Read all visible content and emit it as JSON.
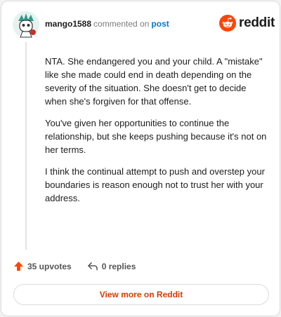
{
  "header": {
    "username": "mango1588",
    "action_text": "commented on",
    "post_link": "post",
    "logo_text": "reddit"
  },
  "comment": {
    "paragraphs": [
      "NTA. She endangered you and your child. A \"mistake\" like she made could end in death depending on the severity of the situation. She doesn't get to decide when she's forgiven for that offense.",
      "You've given her opportunities to continue the relationship, but she keeps pushing because it's not on her terms.",
      "I think the continual attempt to push and overstep your boundaries is reason enough not to trust her with your address."
    ]
  },
  "actions": {
    "upvotes": "35 upvotes",
    "replies": "0 replies"
  },
  "footer": {
    "view_more": "View more on Reddit"
  },
  "colors": {
    "brand": "#ff4500",
    "link": "#0079d3",
    "cta": "#d93a00"
  },
  "icons": [
    "avatar-icon",
    "reddit-logo-icon",
    "upvote-arrow-icon",
    "reply-arrow-icon"
  ]
}
